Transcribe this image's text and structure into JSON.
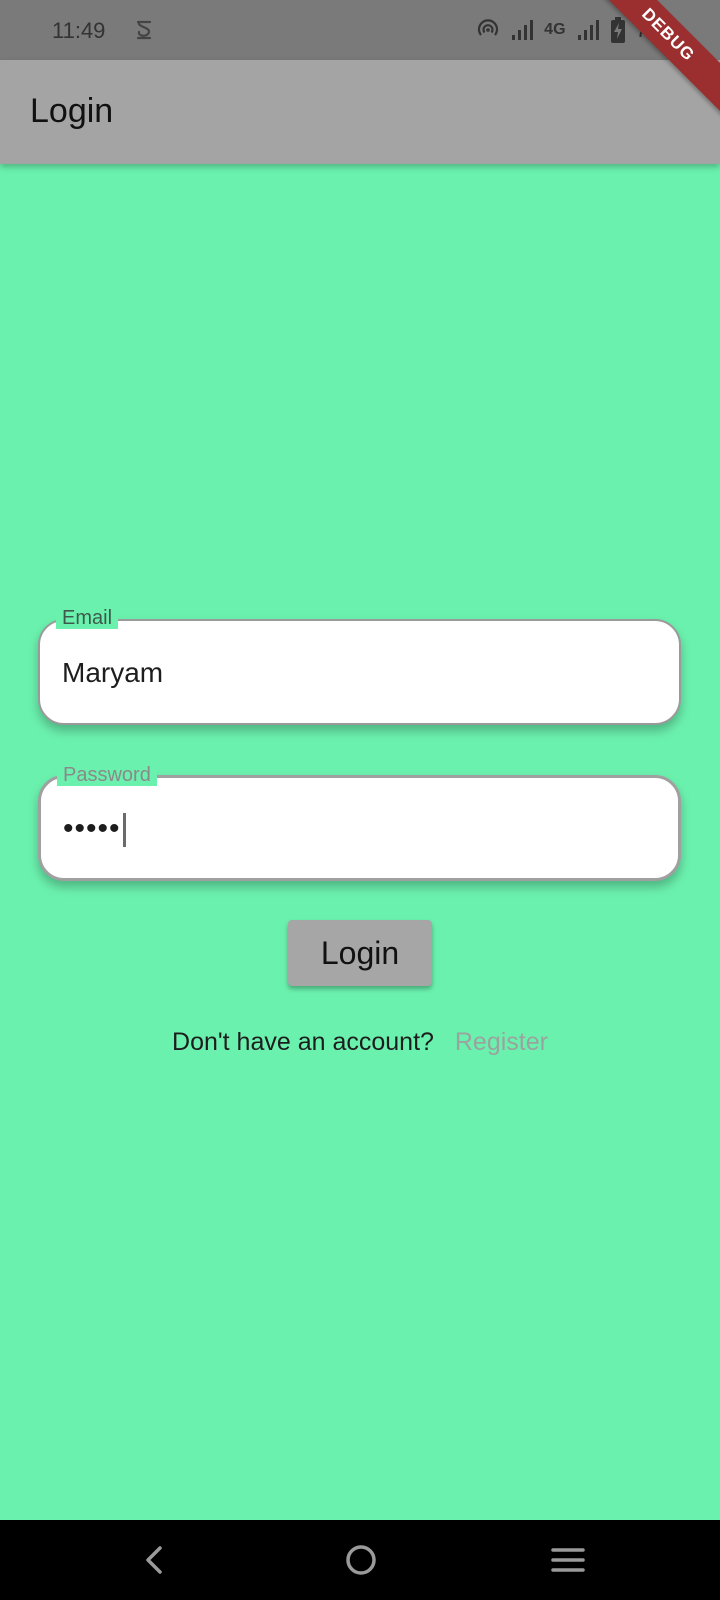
{
  "status_bar": {
    "time": "11:49",
    "network_type": "4G",
    "battery": "78"
  },
  "debug_banner": "DEBUG",
  "app_bar": {
    "title": "Login"
  },
  "form": {
    "email": {
      "label": "Email",
      "value": "Maryam"
    },
    "password": {
      "label": "Password",
      "value": "•••••"
    },
    "login_button": "Login"
  },
  "register": {
    "prompt": "Don't have an account?",
    "link": "Register"
  },
  "colors": {
    "background": "#6bf1ae",
    "app_bar": "#a4a4a4",
    "button": "#a6a6a6",
    "debug_banner": "#9b2f2f"
  },
  "nav_bar": {
    "icons": [
      "back-icon",
      "home-icon",
      "menu-icon"
    ]
  }
}
